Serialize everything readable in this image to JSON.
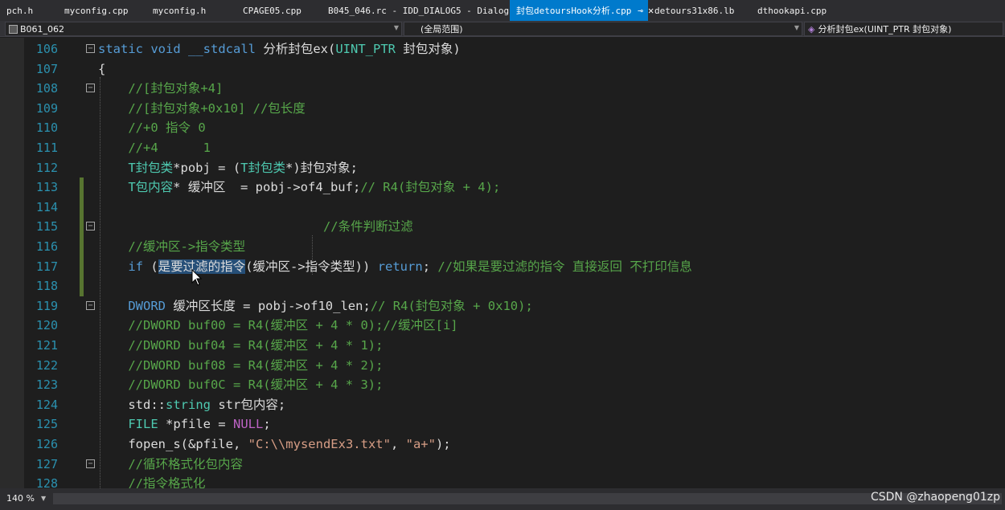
{
  "tabs": [
    {
      "label": "pch.h"
    },
    {
      "label": "myconfig.cpp"
    },
    {
      "label": "myconfig.h"
    },
    {
      "label": "CPAGE05.cpp"
    },
    {
      "label": "B045_046.rc - IDD_DIALOG5 - Dialog"
    },
    {
      "label": "封包detoursHook分析.cpp",
      "active": true
    },
    {
      "label": "detours31x86.lb"
    },
    {
      "label": "dthookapi.cpp"
    }
  ],
  "tab_pin_glyph": "⊸",
  "tab_close_glyph": "✕",
  "navbar": {
    "project": "B061_062",
    "scope": "(全局范围)",
    "function": "分析封包ex(UINT_PTR 封包对象)"
  },
  "status": {
    "zoom": "140 %",
    "watermark": "CSDN @zhaopeng01zp"
  },
  "code_lines": [
    {
      "n": "106",
      "fold": "⊟",
      "changed": false,
      "tokens": [
        [
          "kw",
          "static "
        ],
        [
          "kw",
          "void "
        ],
        [
          "kw",
          "__stdcall "
        ],
        [
          "pl",
          "分析封包ex("
        ],
        [
          "ty",
          "UINT_PTR"
        ],
        [
          "pl",
          " 封包对象)"
        ]
      ]
    },
    {
      "n": "107",
      "fold": "",
      "changed": false,
      "tokens": [
        [
          "pl",
          "{"
        ]
      ]
    },
    {
      "n": "108",
      "fold": "⊟",
      "changed": false,
      "tokens": [
        [
          "pl",
          "    "
        ],
        [
          "cm",
          "//[封包对象+4]"
        ]
      ]
    },
    {
      "n": "109",
      "fold": "",
      "changed": false,
      "tokens": [
        [
          "pl",
          "    "
        ],
        [
          "cm",
          "//[封包对象+0x10] //包长度"
        ]
      ]
    },
    {
      "n": "110",
      "fold": "",
      "changed": false,
      "tokens": [
        [
          "pl",
          "    "
        ],
        [
          "cm",
          "//+0 指令 0"
        ]
      ]
    },
    {
      "n": "111",
      "fold": "",
      "changed": false,
      "tokens": [
        [
          "pl",
          "    "
        ],
        [
          "cm",
          "//+4      1"
        ]
      ]
    },
    {
      "n": "112",
      "fold": "",
      "changed": false,
      "tokens": [
        [
          "pl",
          "    "
        ],
        [
          "ty",
          "T封包类"
        ],
        [
          "pl",
          "*pobj = ("
        ],
        [
          "ty",
          "T封包类"
        ],
        [
          "pl",
          "*)封包对象;"
        ]
      ]
    },
    {
      "n": "113",
      "fold": "",
      "changed": true,
      "tokens": [
        [
          "pl",
          "    "
        ],
        [
          "ty",
          "T包内容"
        ],
        [
          "pl",
          "* 缓冲区  = pobj->of4_buf;"
        ],
        [
          "cm",
          "// R4(封包对象 + 4);"
        ]
      ]
    },
    {
      "n": "114",
      "fold": "",
      "changed": true,
      "tokens": [
        [
          "pl",
          ""
        ]
      ]
    },
    {
      "n": "115",
      "fold": "⊟",
      "changed": true,
      "tokens": [
        [
          "pl",
          "                              "
        ],
        [
          "cm",
          "//条件判断过滤"
        ]
      ]
    },
    {
      "n": "116",
      "fold": "",
      "changed": true,
      "tokens": [
        [
          "pl",
          "    "
        ],
        [
          "cm",
          "//缓冲区->指令类型"
        ]
      ]
    },
    {
      "n": "117",
      "fold": "",
      "changed": true,
      "tokens": [
        [
          "pl",
          "    "
        ],
        [
          "kw",
          "if "
        ],
        [
          "pl",
          "("
        ],
        [
          "sel",
          "是要过滤的指令"
        ],
        [
          "pl",
          "(缓冲区->指令类型)) "
        ],
        [
          "kw",
          "return"
        ],
        [
          "pl",
          "; "
        ],
        [
          "cm",
          "//如果是要过滤的指令 直接返回 不打印信息"
        ]
      ]
    },
    {
      "n": "118",
      "fold": "",
      "changed": true,
      "tokens": [
        [
          "pl",
          ""
        ]
      ]
    },
    {
      "n": "119",
      "fold": "⊟",
      "changed": false,
      "tokens": [
        [
          "pl",
          "    "
        ],
        [
          "kw",
          "DWORD "
        ],
        [
          "pl",
          "缓冲区长度 = pobj->of10_len;"
        ],
        [
          "cm",
          "// R4(封包对象 + 0x10);"
        ]
      ]
    },
    {
      "n": "120",
      "fold": "",
      "changed": false,
      "tokens": [
        [
          "pl",
          "    "
        ],
        [
          "cm",
          "//DWORD buf00 = R4(缓冲区 + 4 * 0);//缓冲区[i]"
        ]
      ]
    },
    {
      "n": "121",
      "fold": "",
      "changed": false,
      "tokens": [
        [
          "pl",
          "    "
        ],
        [
          "cm",
          "//DWORD buf04 = R4(缓冲区 + 4 * 1);"
        ]
      ]
    },
    {
      "n": "122",
      "fold": "",
      "changed": false,
      "tokens": [
        [
          "pl",
          "    "
        ],
        [
          "cm",
          "//DWORD buf08 = R4(缓冲区 + 4 * 2);"
        ]
      ]
    },
    {
      "n": "123",
      "fold": "",
      "changed": false,
      "tokens": [
        [
          "pl",
          "    "
        ],
        [
          "cm",
          "//DWORD buf0C = R4(缓冲区 + 4 * 3);"
        ]
      ]
    },
    {
      "n": "124",
      "fold": "",
      "changed": false,
      "tokens": [
        [
          "pl",
          "    std::"
        ],
        [
          "ty",
          "string"
        ],
        [
          "pl",
          " str包内容;"
        ]
      ]
    },
    {
      "n": "125",
      "fold": "",
      "changed": false,
      "tokens": [
        [
          "pl",
          "    "
        ],
        [
          "ty",
          "FILE"
        ],
        [
          "pl",
          " *pfile = "
        ],
        [
          "mac",
          "NULL"
        ],
        [
          "pl",
          ";"
        ]
      ]
    },
    {
      "n": "126",
      "fold": "",
      "changed": false,
      "tokens": [
        [
          "pl",
          "    fopen_s(&pfile, "
        ],
        [
          "st",
          "\"C:\\\\mysendEx3.txt\""
        ],
        [
          "pl",
          ", "
        ],
        [
          "st",
          "\"a+\""
        ],
        [
          "pl",
          ");"
        ]
      ]
    },
    {
      "n": "127",
      "fold": "⊟",
      "changed": false,
      "tokens": [
        [
          "pl",
          "    "
        ],
        [
          "cm",
          "//循环格式化包内容"
        ]
      ]
    },
    {
      "n": "128",
      "fold": "",
      "changed": false,
      "tokens": [
        [
          "pl",
          "    "
        ],
        [
          "cm",
          "//指令格式化"
        ]
      ]
    }
  ]
}
